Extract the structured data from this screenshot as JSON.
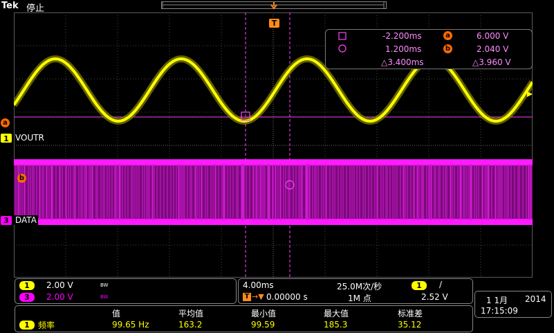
{
  "header": {
    "brand": "Tek",
    "run_state": "停止",
    "trigger_marker": "T"
  },
  "cursor_readout": {
    "t1": "-2.200ms",
    "t2": "1.200ms",
    "dt": "△3.400ms",
    "a_label": "a",
    "b_label": "b",
    "va": "6.000 V",
    "vb": "2.040 V",
    "dv": "△3.960 V"
  },
  "channels": {
    "ch1": {
      "tag": "1",
      "name": "VOUTR",
      "cursor_marker": "a",
      "color": "#ffff00"
    },
    "ch3": {
      "tag": "3",
      "name": "DATA",
      "cursor_marker": "b",
      "color": "#ff00ff"
    }
  },
  "vertical_panel": {
    "ch1": {
      "tag": "1",
      "scale": "2.00 V",
      "bw": "BW"
    },
    "ch3": {
      "tag": "3",
      "scale": "2.00 V",
      "bw": "BW"
    }
  },
  "horizontal_panel": {
    "timebase": "4.00ms",
    "sample_rate": "25.0M次/秒",
    "trigger_source": "1",
    "slope": "/",
    "delay": "0.00000 s",
    "record_length": "1M 点",
    "trigger_level": "2.52 V"
  },
  "datetime": {
    "date": "1 1月",
    "year": "2014",
    "time": "17:15:09"
  },
  "measurements": {
    "headers": [
      "值",
      "平均值",
      "最小值",
      "最大值",
      "标准差"
    ],
    "row": {
      "tag": "1",
      "name": "频率",
      "value": "99.65 Hz",
      "mean": "163.2",
      "min": "99.59",
      "max": "185.3",
      "std": "35.12"
    }
  },
  "colors": {
    "ch1": "#ffff00",
    "ch3": "#ff00ff",
    "cursor": "#ff6600",
    "grid": "#6e6e6e"
  }
}
